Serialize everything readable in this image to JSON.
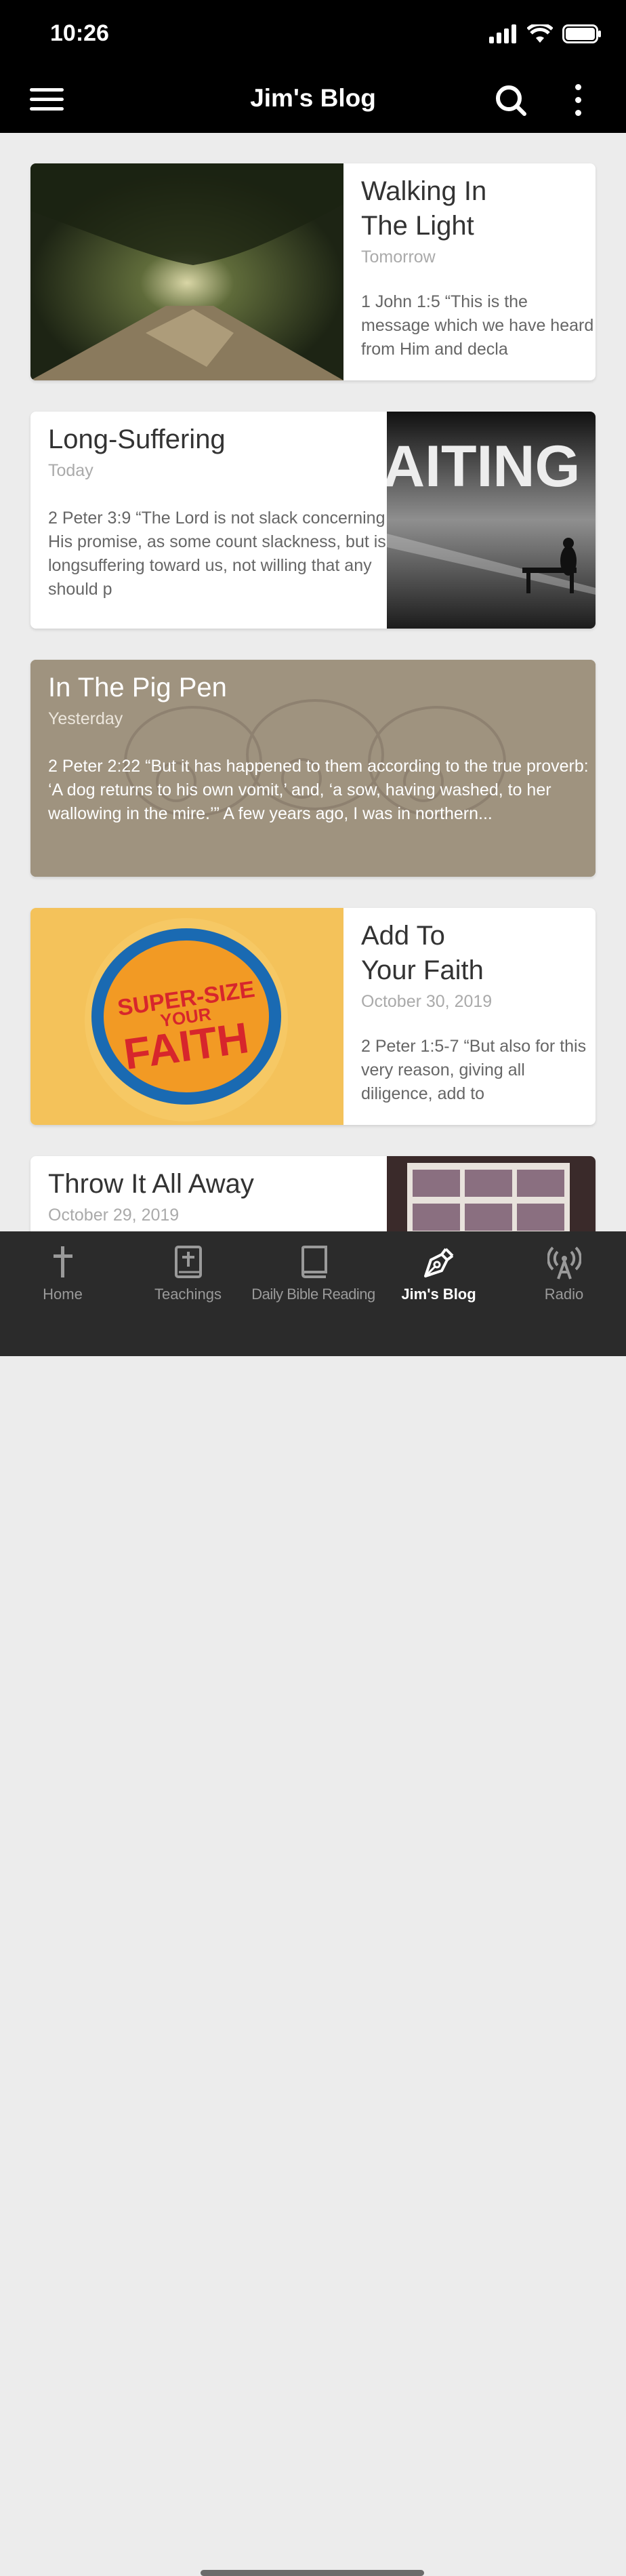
{
  "status": {
    "time": "10:26"
  },
  "header": {
    "title": "Jim's Blog"
  },
  "posts": [
    {
      "title_line1": "Walking In",
      "title_line2": "The Light",
      "date": "Tomorrow",
      "excerpt": "1 John 1:5 “This is the message which we have heard from Him and decla"
    },
    {
      "title": "Long-Suffering",
      "date": "Today",
      "excerpt": "2 Peter 3:9 “The Lord is not slack concerning His promise, as some count slackness, but is longsuffering toward us, not willing that any should p",
      "image_text": "AITING"
    },
    {
      "title": "In The Pig Pen",
      "date": "Yesterday",
      "excerpt": "2 Peter 2:22 “But it has happened to them according to the true proverb: ‘A dog returns to his own vomit,’ and, ‘a sow, having washed, to her wallowing in the mire.’” A few years ago, I was in northern..."
    },
    {
      "title_line1": "Add To",
      "title_line2": "Your Faith",
      "date": "October 30, 2019",
      "excerpt": "2 Peter 1:5-7 “But also for this very reason, giving all diligence, add to",
      "image_text": [
        "SUPER-SIZE",
        "YOUR",
        "FAITH"
      ]
    },
    {
      "title": "Throw It All Away",
      "date": "October 29, 2019"
    }
  ],
  "tabs": [
    {
      "label": "Home",
      "icon": "cross-icon"
    },
    {
      "label": "Teachings",
      "icon": "bible-icon"
    },
    {
      "label": "Daily Bible Reading",
      "icon": "book-icon"
    },
    {
      "label": "Jim's Blog",
      "icon": "pen-icon",
      "active": true
    },
    {
      "label": "Radio",
      "icon": "radio-tower-icon"
    }
  ]
}
